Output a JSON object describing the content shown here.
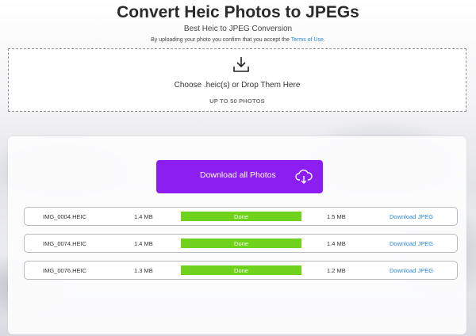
{
  "header": {
    "title": "Convert Heic Photos to JPEGs",
    "subtitle": "Best Heic to JPEG Conversion",
    "consent_text": "By uploading your photo you confirm that you accept the",
    "terms_link": "Terms of Use."
  },
  "dropzone": {
    "icon": "download-tray-icon",
    "label": "Choose .heic(s) or Drop Them Here",
    "limit": "UP TO 50 PHOTOS"
  },
  "actions": {
    "download_all_label": "Download all Photos",
    "download_all_icon": "cloud-download-icon",
    "accent_color": "#8d1ef2"
  },
  "files": [
    {
      "name": "IMG_0004.HEIC",
      "original_size": "1.4 MB",
      "status": "Done",
      "progress": 1.0,
      "converted_size": "1.5 MB",
      "link": "Download JPEG"
    },
    {
      "name": "IMG_0074.HEIC",
      "original_size": "1.4 MB",
      "status": "Done",
      "progress": 1.0,
      "converted_size": "1.4 MB",
      "link": "Download JPEG"
    },
    {
      "name": "IMG_0076.HEIC",
      "original_size": "1.3 MB",
      "status": "Done",
      "progress": 1.0,
      "converted_size": "1.2 MB",
      "link": "Download JPEG"
    }
  ],
  "colors": {
    "progress_done": "#6fd21c",
    "link": "#2b88d8"
  }
}
